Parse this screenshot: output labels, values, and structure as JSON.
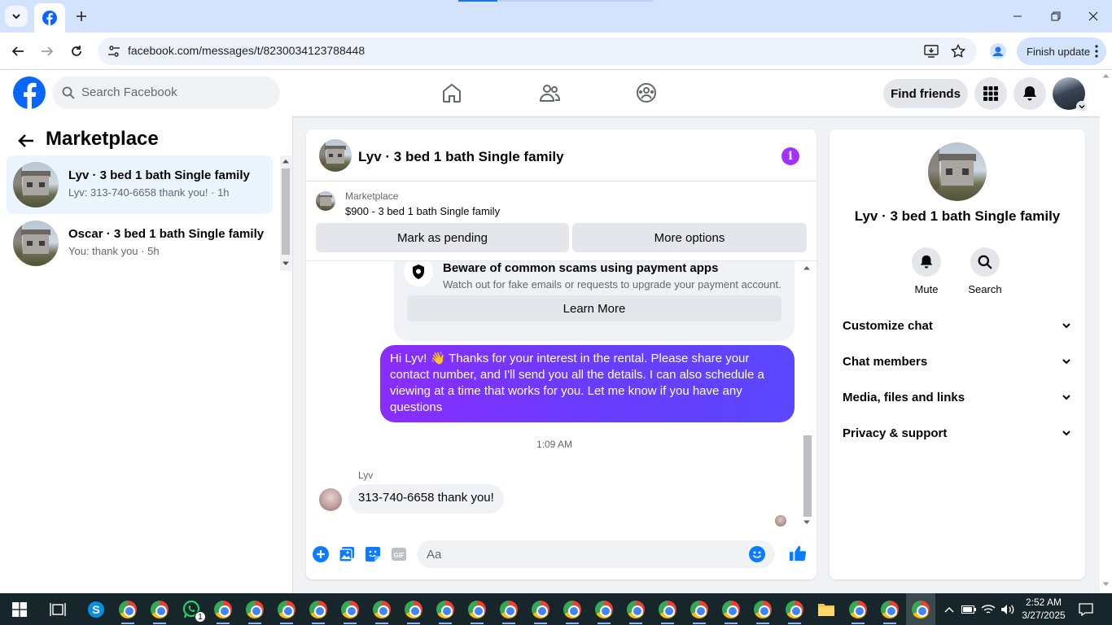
{
  "browser": {
    "url": "facebook.com/messages/t/8230034123788448",
    "finish_update": "Finish update"
  },
  "fb": {
    "search_placeholder": "Search Facebook",
    "find_friends": "Find friends"
  },
  "sidebar": {
    "title": "Marketplace",
    "items": [
      {
        "name": "Lyv · 3 bed 1 bath Single family",
        "sub": "Lyv: 313-740-6658 thank you! · 1h"
      },
      {
        "name": "Oscar · 3 bed 1 bath Single family",
        "sub": "You: thank you · 5h"
      }
    ]
  },
  "chat": {
    "title": "Lyv · 3 bed 1 bath Single family",
    "marketplace_label": "Marketplace",
    "listing": "$900 - 3 bed 1 bath Single family",
    "mark_pending": "Mark as pending",
    "more_options": "More options",
    "scam_title": "Beware of common scams using payment apps",
    "scam_body": "Watch out for fake emails or requests to upgrade your payment account.",
    "learn_more": "Learn More",
    "outgoing": "Hi Lyv! 👋 Thanks for your interest in the rental. Please share your contact number, and I'll send you all the details. I can also schedule a viewing at a time that works for you. Let me know if you have any questions",
    "timestamp": "1:09 AM",
    "sender": "Lyv",
    "incoming": "313-740-6658 thank you!",
    "composer_placeholder": "Aa"
  },
  "info": {
    "title": "Lyv · 3 bed 1 bath Single family",
    "mute": "Mute",
    "search": "Search",
    "sections": [
      "Customize chat",
      "Chat members",
      "Media, files and links",
      "Privacy & support"
    ]
  },
  "taskbar": {
    "time": "2:52 AM",
    "date": "3/27/2025",
    "whatsapp_badge": "1"
  },
  "colors": {
    "fb_blue": "#0866ff",
    "messenger_purple": "#a033ff",
    "taskbar": "#17262b"
  }
}
